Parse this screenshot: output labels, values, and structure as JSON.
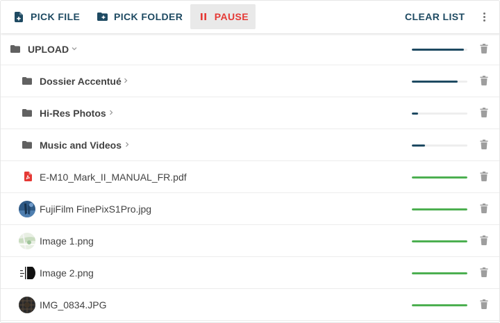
{
  "toolbar": {
    "pick_file": "PICK FILE",
    "pick_folder": "PICK FOLDER",
    "pause": "PAUSE",
    "clear_list": "CLEAR LIST"
  },
  "colors": {
    "brand": "#1e4a62",
    "pause": "#e53935",
    "complete": "#4caf50",
    "track": "#eeeeee",
    "pdf": "#e53935",
    "icon_gray": "#616161"
  },
  "rows": [
    {
      "kind": "folder",
      "name": "UPLOAD",
      "chevron": "chevron-down-icon",
      "progress": 0.94,
      "status": "uploading"
    },
    {
      "kind": "folder",
      "name": "Dossier Accentué",
      "chevron": "chevron-right-icon",
      "progress": 0.83,
      "status": "uploading"
    },
    {
      "kind": "folder",
      "name": "Hi-Res Photos",
      "chevron": "chevron-right-icon",
      "progress": 0.11,
      "status": "uploading"
    },
    {
      "kind": "folder",
      "name": "Music and Videos",
      "chevron": "chevron-right-icon",
      "progress": 0.24,
      "status": "uploading"
    },
    {
      "kind": "pdf",
      "name": "E-M10_Mark_II_MANUAL_FR.pdf",
      "progress": 1.0,
      "status": "complete"
    },
    {
      "kind": "image",
      "name": "FujiFilm FinePixS1Pro.jpg",
      "thumb": "blue",
      "progress": 1.0,
      "status": "complete"
    },
    {
      "kind": "image",
      "name": "Image 1.png",
      "thumb": "map",
      "progress": 1.0,
      "status": "complete"
    },
    {
      "kind": "image",
      "name": "Image 2.png",
      "thumb": "bw",
      "progress": 1.0,
      "status": "complete"
    },
    {
      "kind": "image",
      "name": "IMG_0834.JPG",
      "thumb": "dark",
      "progress": 1.0,
      "status": "complete"
    }
  ]
}
